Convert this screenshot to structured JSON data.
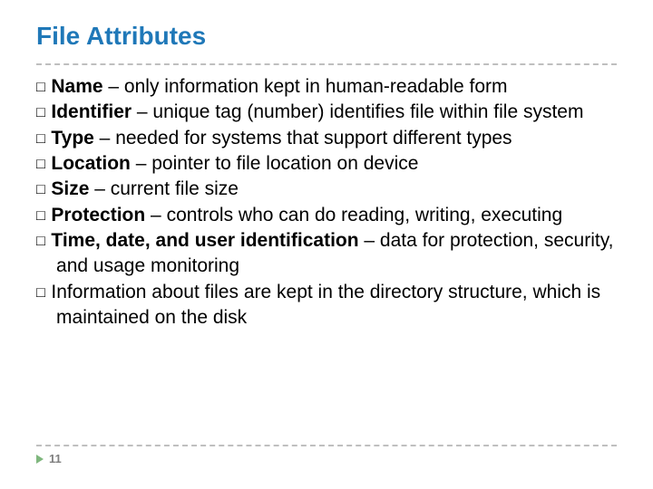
{
  "title": "File Attributes",
  "bullet_glyph": "□",
  "items": [
    {
      "bold": "Name",
      "rest": " – only information kept in human-readable form"
    },
    {
      "bold": "Identifier",
      "rest": " – unique tag (number) identifies file within file system"
    },
    {
      "bold": "Type",
      "rest": " – needed for systems that support different types"
    },
    {
      "bold": "Location",
      "rest": " – pointer to file location on device"
    },
    {
      "bold": "Size",
      "rest": " – current file size"
    },
    {
      "bold": "Protection",
      "rest": " – controls who can do reading, writing, executing"
    },
    {
      "bold": "Time, date, and user identification",
      "rest": " – data for protection, security, and usage monitoring"
    },
    {
      "bold": "",
      "rest": "Information about files are kept in the directory structure, which is maintained on the disk"
    }
  ],
  "page_number": "11"
}
